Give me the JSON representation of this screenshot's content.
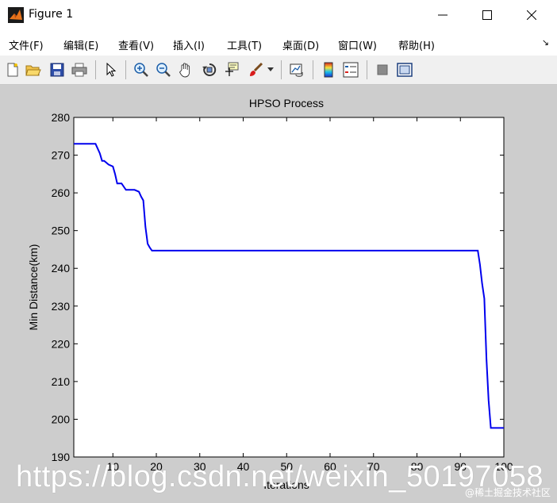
{
  "window": {
    "title": "Figure 1",
    "minimize_glyph": "—",
    "maximize_glyph": "☐",
    "close_glyph": "✕"
  },
  "menu": {
    "items": [
      "文件(F)",
      "编辑(E)",
      "查看(V)",
      "插入(I)",
      "工具(T)",
      "桌面(D)",
      "窗口(W)",
      "帮助(H)"
    ],
    "extra_glyph": "↘"
  },
  "toolbar": {
    "icons": [
      "new-figure-icon",
      "open-file-icon",
      "save-icon",
      "print-icon",
      "select-arrow-icon",
      "zoom-in-icon",
      "zoom-out-icon",
      "pan-hand-icon",
      "rotate-3d-icon",
      "data-cursor-icon",
      "brush-icon",
      "brush-dropdown-icon",
      "link-plot-icon",
      "colorbar-icon",
      "legend-icon",
      "hide-plot-tools-icon",
      "show-plot-tools-icon"
    ]
  },
  "chart_data": {
    "type": "line",
    "title": "HPSO Process",
    "xlabel": "Iterations",
    "ylabel": "Min Distance(km)",
    "xlim": [
      1,
      100
    ],
    "ylim": [
      190,
      280
    ],
    "xticks": [
      10,
      20,
      30,
      40,
      50,
      60,
      70,
      80,
      90,
      100
    ],
    "yticks": [
      190,
      200,
      210,
      220,
      230,
      240,
      250,
      260,
      270,
      280
    ],
    "grid": false,
    "line_color": "#0000ee",
    "series": [
      {
        "x": [
          1,
          6,
          7,
          7.5,
          8,
          9,
          10,
          10.5,
          11,
          12,
          13,
          14,
          15,
          16,
          16.5,
          17,
          17.5,
          18,
          18.5,
          19,
          20,
          30,
          40,
          50,
          60,
          70,
          80,
          90,
          94,
          94.5,
          95,
          95.5,
          96,
          96.5,
          97,
          98,
          99,
          100
        ],
        "y": [
          273,
          273,
          270.5,
          268.5,
          268.5,
          267.5,
          267,
          265,
          262.5,
          262.5,
          260.8,
          260.8,
          260.8,
          260.3,
          259,
          258,
          251,
          246.5,
          245.5,
          244.7,
          244.7,
          244.7,
          244.7,
          244.7,
          244.7,
          244.7,
          244.7,
          244.7,
          244.7,
          241,
          236,
          232,
          216,
          205,
          197.7,
          197.7,
          197.7,
          197.7
        ]
      }
    ]
  },
  "watermark": {
    "text": "https://blog.csdn.net/weixin_50197058",
    "corner_text": "@稀土掘金技术社区"
  }
}
